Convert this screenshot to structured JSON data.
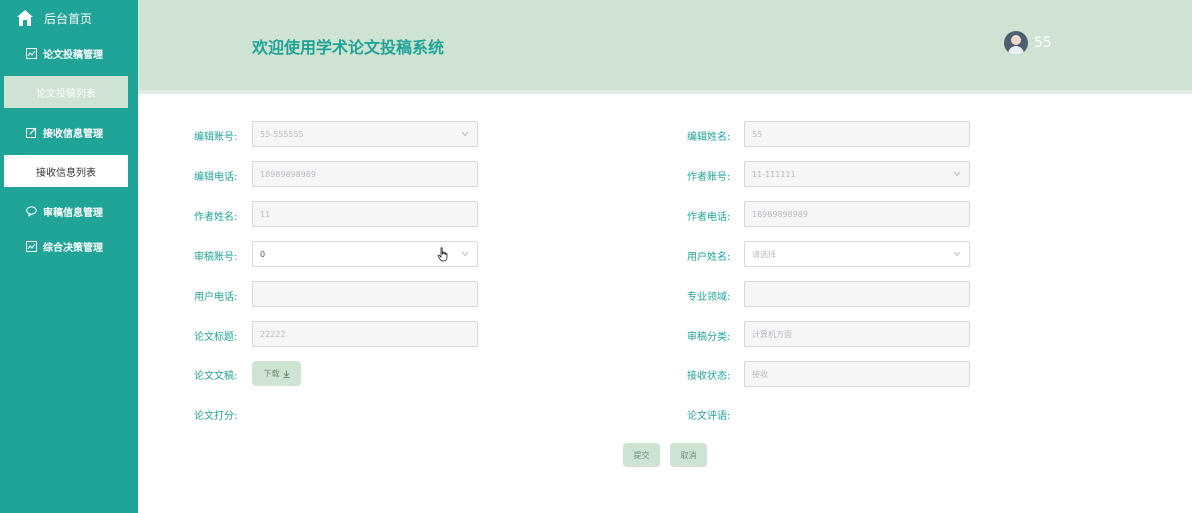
{
  "sidebar": {
    "home_label": "后台首页",
    "groups": [
      {
        "label": "论文投稿管理",
        "icon": "chart-icon"
      },
      {
        "label": "接收信息管理",
        "icon": "edit-icon"
      },
      {
        "label": "审稿信息管理",
        "icon": "message-icon"
      },
      {
        "label": "综合决策管理",
        "icon": "chart-icon"
      }
    ],
    "subs": [
      {
        "label": "论文投稿列表",
        "active": true
      },
      {
        "label": "接收信息列表",
        "active": false
      }
    ]
  },
  "header": {
    "title": "欢迎使用学术论文投稿系统",
    "username": "55"
  },
  "form": {
    "editor_account": {
      "label": "编辑账号:",
      "value": "55-555555"
    },
    "editor_name": {
      "label": "编辑姓名:",
      "value": "55"
    },
    "editor_phone": {
      "label": "编辑电话:",
      "value": "18989898989"
    },
    "author_account": {
      "label": "作者账号:",
      "value": "11-111111"
    },
    "author_name": {
      "label": "作者姓名:",
      "value": "11"
    },
    "author_phone": {
      "label": "作者电话:",
      "value": "18989898989"
    },
    "reviewer_account": {
      "label": "审稿账号:",
      "value": "0"
    },
    "user_name": {
      "label": "用户姓名:",
      "placeholder": "请选择"
    },
    "user_phone": {
      "label": "用户电话:",
      "value": ""
    },
    "field_area": {
      "label": "专业领域:",
      "value": ""
    },
    "paper_title": {
      "label": "论文标题:",
      "value": "22222"
    },
    "review_category": {
      "label": "审稿分类:",
      "value": "计算机方面"
    },
    "paper_doc": {
      "label": "论文文稿:",
      "button": "下载"
    },
    "receive_status": {
      "label": "接收状态:",
      "value": "接收"
    },
    "paper_score": {
      "label": "论文打分:"
    },
    "paper_comment": {
      "label": "论文评语:"
    }
  },
  "actions": {
    "submit": "提交",
    "cancel": "取消"
  },
  "colors": {
    "sidebar_bg": "#1fa497",
    "header_bg": "#cfe3d2",
    "accent": "#1fa497"
  }
}
